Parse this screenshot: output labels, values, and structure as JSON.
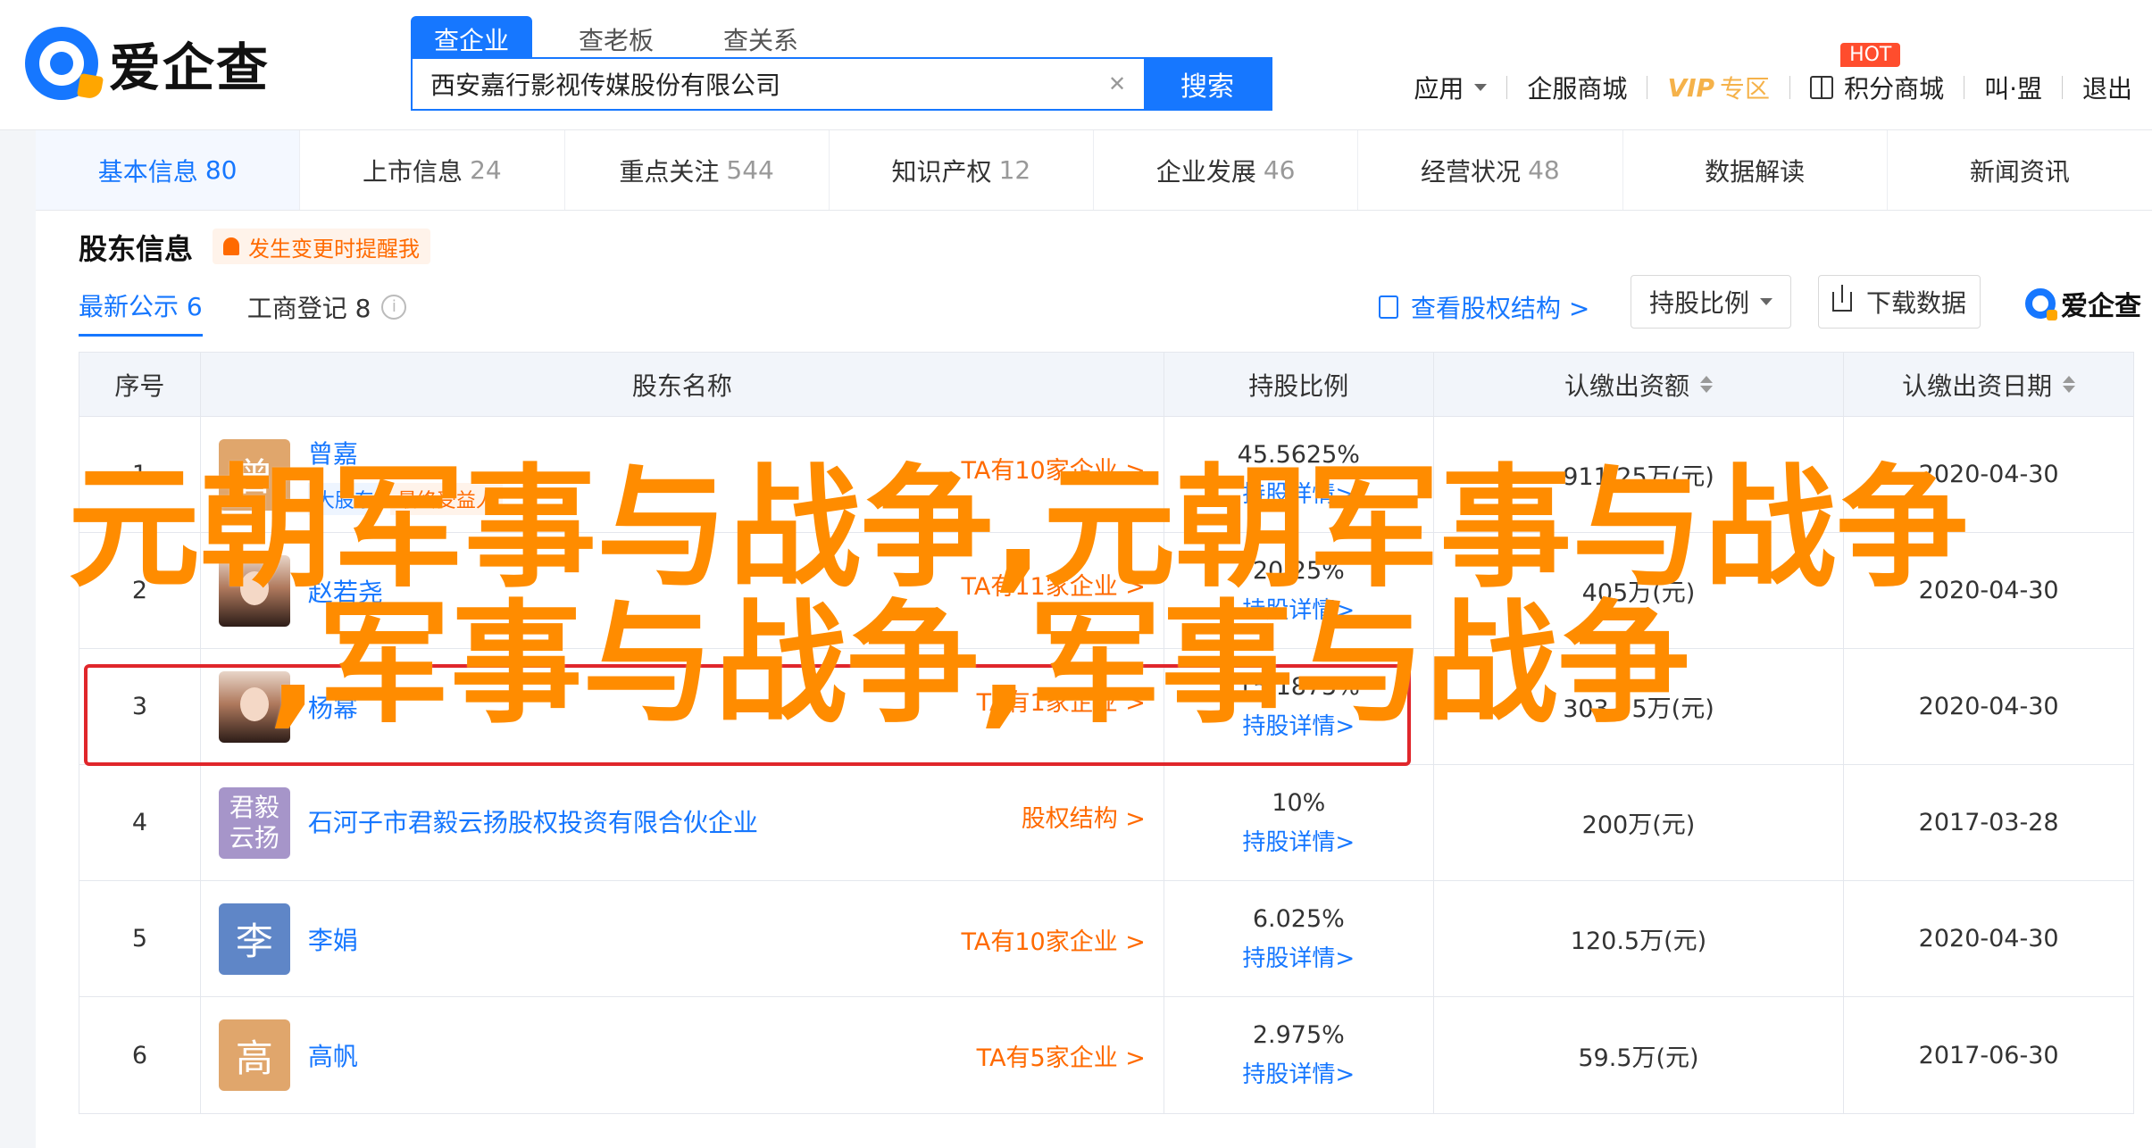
{
  "brand": {
    "name": "爱企查"
  },
  "search": {
    "tabs": [
      "查企业",
      "查老板",
      "查关系"
    ],
    "value": "西安嘉行影视传媒股份有限公司",
    "button": "搜索"
  },
  "topnav": {
    "app": "应用",
    "service": "企服商城",
    "vip": "VIP",
    "vip_zone": "专区",
    "points": "积分商城",
    "hot": "HOT",
    "more": "叫·盟",
    "logout": "退出"
  },
  "categories": [
    {
      "label": "基本信息",
      "count": "80"
    },
    {
      "label": "上市信息",
      "count": "24"
    },
    {
      "label": "重点关注",
      "count": "544"
    },
    {
      "label": "知识产权",
      "count": "12"
    },
    {
      "label": "企业发展",
      "count": "46"
    },
    {
      "label": "经营状况",
      "count": "48"
    },
    {
      "label": "数据解读",
      "count": ""
    },
    {
      "label": "新闻资讯",
      "count": ""
    }
  ],
  "section": {
    "title": "股东信息",
    "notify": "发生变更时提醒我",
    "subtabs": [
      "最新公示 6",
      "工商登记 8"
    ],
    "struct_link": "查看股权结构 >",
    "ratio_dropdown": "持股比例",
    "download": "下载数据",
    "brand_mini": "爱企查"
  },
  "table": {
    "headers": [
      "序号",
      "股东名称",
      "持股比例",
      "认缴出资额",
      "认缴出资日期"
    ],
    "rows": [
      {
        "no": "1",
        "avatar": "曾",
        "name": "曾嘉",
        "tags": [
          "大股东",
          "最终受益人"
        ],
        "link": "TA有10家企业 >",
        "pct": "45.5625%",
        "detail": "持股详情>",
        "amount": "911.25万(元)",
        "date": "2020-04-30"
      },
      {
        "no": "2",
        "avatar": "",
        "name": "赵若尧",
        "tags": [],
        "link": "TA有11家企业 >",
        "pct": "20.25%",
        "detail": "持股详情>",
        "amount": "405万(元)",
        "date": "2020-04-30"
      },
      {
        "no": "3",
        "avatar": "",
        "name": "杨幂",
        "tags": [],
        "link": "TA有1家企业 >",
        "pct": "15.1875%",
        "detail": "持股详情>",
        "amount": "303.75万(元)",
        "date": "2020-04-30"
      },
      {
        "no": "4",
        "avatar": "君毅云扬",
        "name": "石河子市君毅云扬股权投资有限合伙企业",
        "tags": [],
        "link": "股权结构 >",
        "pct": "10%",
        "detail": "持股详情>",
        "amount": "200万(元)",
        "date": "2017-03-28"
      },
      {
        "no": "5",
        "avatar": "李",
        "name": "李娟",
        "tags": [],
        "link": "TA有10家企业 >",
        "pct": "6.025%",
        "detail": "持股详情>",
        "amount": "120.5万(元)",
        "date": "2020-04-30"
      },
      {
        "no": "6",
        "avatar": "高",
        "name": "高帆",
        "tags": [],
        "link": "TA有5家企业 >",
        "pct": "2.975%",
        "detail": "持股详情>",
        "amount": "59.5万(元)",
        "date": "2017-06-30"
      }
    ]
  },
  "overlay": {
    "line1": "元朝军事与战争,元朝军事与战争",
    "line2": ",军事与战争,军事与战争"
  },
  "colors": {
    "accent": "#1677ff",
    "orange": "#ff6a00",
    "overlay": "#ff8c00",
    "highlight": "#e0262b",
    "avatar_1": "#e0a66c",
    "avatar_4": "#a695c9",
    "avatar_5": "#5f86c7",
    "avatar_6": "#e0a66c"
  }
}
